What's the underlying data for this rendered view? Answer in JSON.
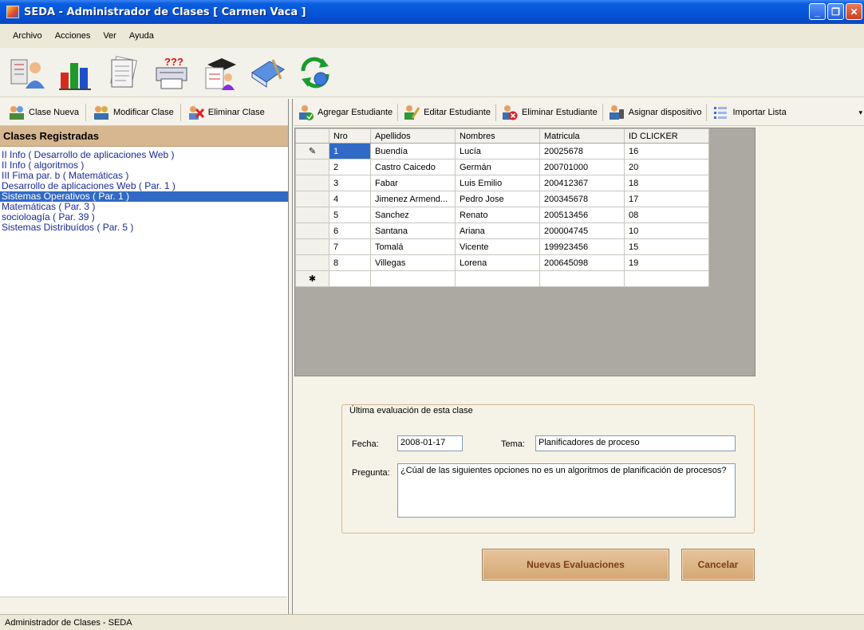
{
  "window": {
    "title": "SEDA - Administrador de Clases [ Carmen Vaca ]"
  },
  "menu": [
    "Archivo",
    "Acciones",
    "Ver",
    "Ayuda"
  ],
  "big_toolbar_icons": [
    "students-report-icon",
    "bar-chart-icon",
    "documents-icon",
    "printer-icon",
    "graduate-icon",
    "book-icon",
    "sync-globe-icon"
  ],
  "left_toolbar": {
    "new_class": "Clase Nueva",
    "edit_class": "Modificar Clase",
    "delete_class": "Eliminar Clase"
  },
  "class_list": {
    "header": "Clases Registradas",
    "items": [
      "II Info ( Desarrollo de aplicaciones Web )",
      "II Info ( algoritmos )",
      "III Fima par. b ( Matemáticas )",
      "Desarrollo de aplicaciones Web ( Par. 1 )",
      "Sistemas Operativos ( Par. 1 )",
      "Matemáticas ( Par. 3 )",
      "socioloagía ( Par. 39 )",
      "Sistemas Distribuídos ( Par. 5 )"
    ],
    "selected_index": 4
  },
  "right_toolbar": {
    "add_student": "Agregar Estudiante",
    "edit_student": "Editar Estudiante",
    "delete_student": "Eliminar Estudiante",
    "assign_device": "Asignar dispositivo",
    "import_list": "Importar Lista"
  },
  "grid": {
    "columns": [
      "Nro",
      "Apellidos",
      "Nombres",
      "Matricula",
      "ID CLICKER"
    ],
    "rows": [
      [
        "1",
        "Buendía",
        "Lucía",
        "20025678",
        "16"
      ],
      [
        "2",
        "Castro Caicedo",
        "Germán",
        "200701000",
        "20"
      ],
      [
        "3",
        "Fabar",
        "Luis Emilio",
        "200412367",
        "18"
      ],
      [
        "4",
        "Jimenez Armend...",
        "Pedro Jose",
        "200345678",
        "17"
      ],
      [
        "5",
        "Sanchez",
        "Renato",
        "200513456",
        "08"
      ],
      [
        "6",
        "Santana",
        "Ariana",
        "200004745",
        "10"
      ],
      [
        "7",
        "Tomalá",
        "Vicente",
        "199923456",
        "15"
      ],
      [
        "8",
        "Villegas",
        "Lorena",
        "200645098",
        "19"
      ]
    ],
    "edit_marker": "✎",
    "new_row_marker": "✱"
  },
  "evaluation": {
    "legend": "Última evaluación de esta clase",
    "date_label": "Fecha:",
    "date_value": "2008-01-17",
    "topic_label": "Tema:",
    "topic_value": "Planificadores de proceso",
    "question_label": "Pregunta:",
    "question_value": "¿Cúal de las siguientes opciones no es un algoritmos de planificación de procesos?"
  },
  "buttons": {
    "new_evaluations": "Nuevas Evaluaciones",
    "cancel": "Cancelar"
  },
  "status": "Administrador de Clases - SEDA",
  "colors": {
    "selection": "#316ac5",
    "list_header": "#d7b78f",
    "button_text": "#7b3d14"
  }
}
